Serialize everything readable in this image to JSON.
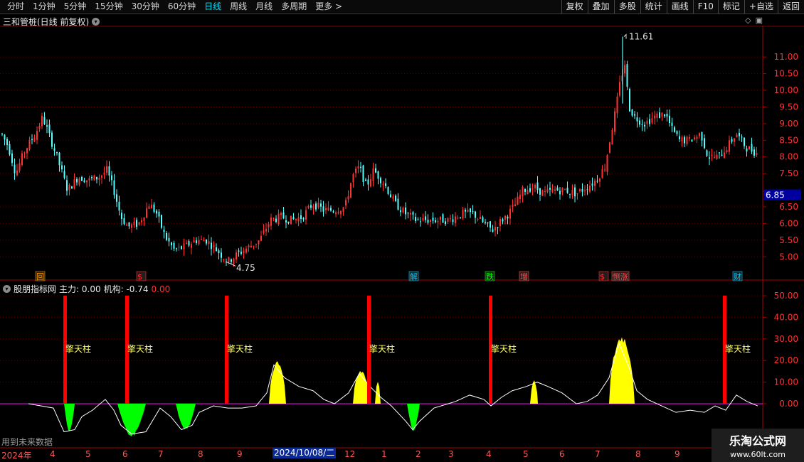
{
  "toolbar": {
    "periods": [
      "分时",
      "1分钟",
      "5分钟",
      "15分钟",
      "30分钟",
      "60分钟",
      "日线",
      "周线",
      "月线",
      "多周期",
      "更多"
    ],
    "active_period": "日线",
    "buttons": [
      "复权",
      "叠加",
      "多股",
      "统计",
      "画线",
      "F10",
      "标记",
      "+自选",
      "返回"
    ]
  },
  "main_chart": {
    "title": "三和管桩(日线 前复权)",
    "high_label": "11.61",
    "low_label": "4.75",
    "current_price": "6.85",
    "y_ticks": [
      "11.00",
      "10.50",
      "10.00",
      "9.50",
      "9.00",
      "8.50",
      "8.00",
      "7.50",
      "6.50",
      "6.00",
      "5.50",
      "5.00"
    ],
    "y_range": [
      4.6,
      11.9
    ],
    "event_markers": [
      {
        "label": "回",
        "color": "#ff9900"
      },
      {
        "label": "$",
        "color": "#ff3030"
      },
      {
        "label": "解",
        "color": "#00c8ff"
      },
      {
        "label": "跌",
        "color": "#00ff00"
      },
      {
        "label": "增",
        "color": "#ff5050"
      },
      {
        "label": "$",
        "color": "#ff3030"
      },
      {
        "label": "恻涨",
        "color": "#ff5050"
      },
      {
        "label": "财",
        "color": "#00c8ff"
      }
    ]
  },
  "indicator": {
    "name": "股朋指标网",
    "main_force": "主力: 0.00",
    "institution": "机构: -0.74",
    "extra": "0.00",
    "y_ticks": [
      "50.00",
      "40.00",
      "30.00",
      "20.00",
      "10.00",
      "0.00"
    ],
    "pillar_label": "擎天柱",
    "pillar_count": 6
  },
  "time_axis": {
    "labels": [
      "2024年",
      "4",
      "5",
      "6",
      "7",
      "8",
      "9",
      "12",
      "1",
      "2",
      "3",
      "4",
      "5",
      "6",
      "7",
      "8",
      "9"
    ],
    "cursor_date": "2024/10/08/二"
  },
  "footer": {
    "future_data_note": "用到未来数据",
    "watermark_title": "乐淘公式网",
    "watermark_url": "www.60lt.com"
  },
  "colors": {
    "up": "#ff3232",
    "down": "#54ffff",
    "yellow_fill": "#ffff00",
    "green_fill": "#00ff00",
    "pillar": "#ff0000",
    "price_tag_bg": "#0000a0"
  }
}
